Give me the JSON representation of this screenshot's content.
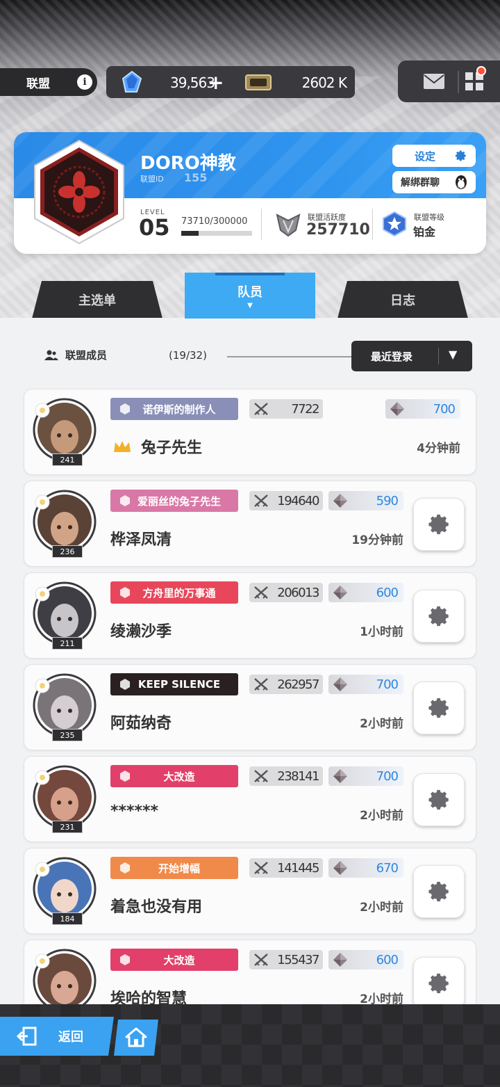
{
  "top_bar": {
    "alliance_tab": "联盟",
    "info_icon": "info-icon",
    "gem_value": "39,563",
    "plus_symbol": "+",
    "ticket_value": "2602 K"
  },
  "alliance": {
    "name": "DORO神教",
    "id_label": "联盟ID",
    "id_value": "155",
    "settings_label": "设定",
    "unbind_label": "解绑群聊",
    "level_label": "LEVEL",
    "level_value": "05",
    "exp_text": "73710/300000",
    "exp_progress": 0.2457,
    "activity_label": "联盟活跃度",
    "activity_value": "257710",
    "rank_label": "联盟等级",
    "rank_value": "铂金"
  },
  "tabs": [
    {
      "label": "主选单",
      "active": false
    },
    {
      "label": "队员",
      "active": true,
      "caret": "▼"
    },
    {
      "label": "日志",
      "active": false
    }
  ],
  "members_header": {
    "label": "联盟成员",
    "count": "(19/32)",
    "sort_label": "最近登录",
    "sort_arrow": "▼"
  },
  "members": [
    {
      "level": "241",
      "badge": "诺伊斯的制作人",
      "badge_color": "#8a8fb8",
      "power": "7722",
      "contribution": "700",
      "name": "兔子先生",
      "time": "4分钟前",
      "leader": true
    },
    {
      "level": "236",
      "badge": "爱丽丝的兔子先生",
      "badge_color": "#d978a6",
      "power": "194640",
      "contribution": "590",
      "name": "桦泽凤清",
      "time": "19分钟前"
    },
    {
      "level": "211",
      "badge": "方舟里的万事通",
      "badge_color": "#e8465a",
      "power": "206013",
      "contribution": "600",
      "name": "绫濑沙季",
      "time": "1小时前"
    },
    {
      "level": "235",
      "badge": "KEEP SILENCE",
      "badge_color": "#2a2022",
      "power": "262957",
      "contribution": "700",
      "name": "阿茹纳奇",
      "time": "2小时前"
    },
    {
      "level": "231",
      "badge": "大改造",
      "badge_color": "#e2406a",
      "power": "238141",
      "contribution": "700",
      "name": "******",
      "time": "2小时前"
    },
    {
      "level": "184",
      "badge": "开始增幅",
      "badge_color": "#f08a4a",
      "power": "141445",
      "contribution": "670",
      "name": "着急也没有用",
      "time": "2小时前"
    },
    {
      "level": "",
      "badge": "大改造",
      "badge_color": "#e2406a",
      "power": "155437",
      "contribution": "600",
      "name": "埃哈的智慧",
      "time": "2小时前"
    }
  ],
  "bottom_bar": {
    "back_label": "返回"
  },
  "colors": {
    "accent_blue": "#2f95ef",
    "dark": "#2f2f32",
    "notification": "#ff4f3b"
  }
}
